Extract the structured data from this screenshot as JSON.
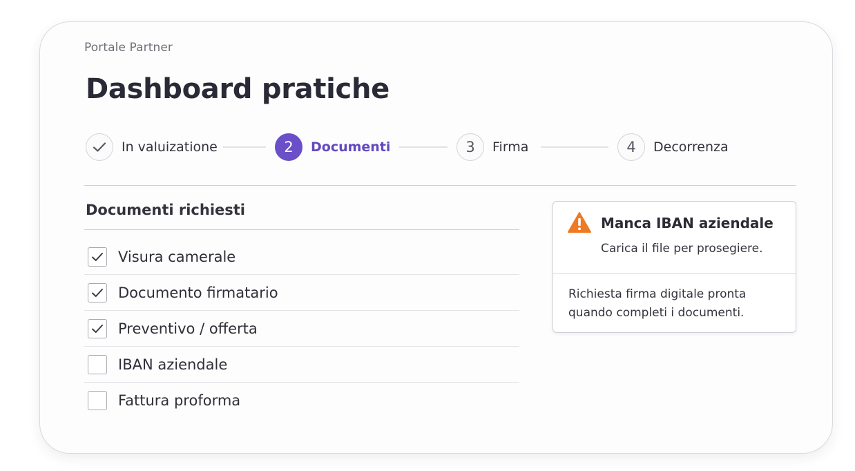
{
  "header": {
    "breadcrumb": "Portale Partner",
    "title": "Dashboard pratiche"
  },
  "stepper": {
    "steps": [
      {
        "number": "",
        "label": "In valuizatione",
        "state": "completed",
        "icon": "check-icon"
      },
      {
        "number": "2",
        "label": "Documenti",
        "state": "active"
      },
      {
        "number": "3",
        "label": "Firma",
        "state": "pending"
      },
      {
        "number": "4",
        "label": "Decorrenza",
        "state": "pending"
      }
    ]
  },
  "documents": {
    "title": "Documenti richiesti",
    "items": [
      {
        "label": "Visura camerale",
        "checked": true
      },
      {
        "label": "Documento firmatario",
        "checked": true
      },
      {
        "label": "Preventivo / offerta",
        "checked": true
      },
      {
        "label": "IBAN aziendale",
        "checked": false
      },
      {
        "label": "Fattura proforma",
        "checked": false
      }
    ]
  },
  "alert": {
    "icon": "warning-icon",
    "title": "Manca IBAN aziendale",
    "subtitle": "Carica il file per prosegiere.",
    "note": "Richiesta firma digitale pronta quando completi i documenti."
  },
  "colors": {
    "accent": "#6a4fc9",
    "warning": "#ee7a24",
    "border": "#cfcfd4"
  }
}
